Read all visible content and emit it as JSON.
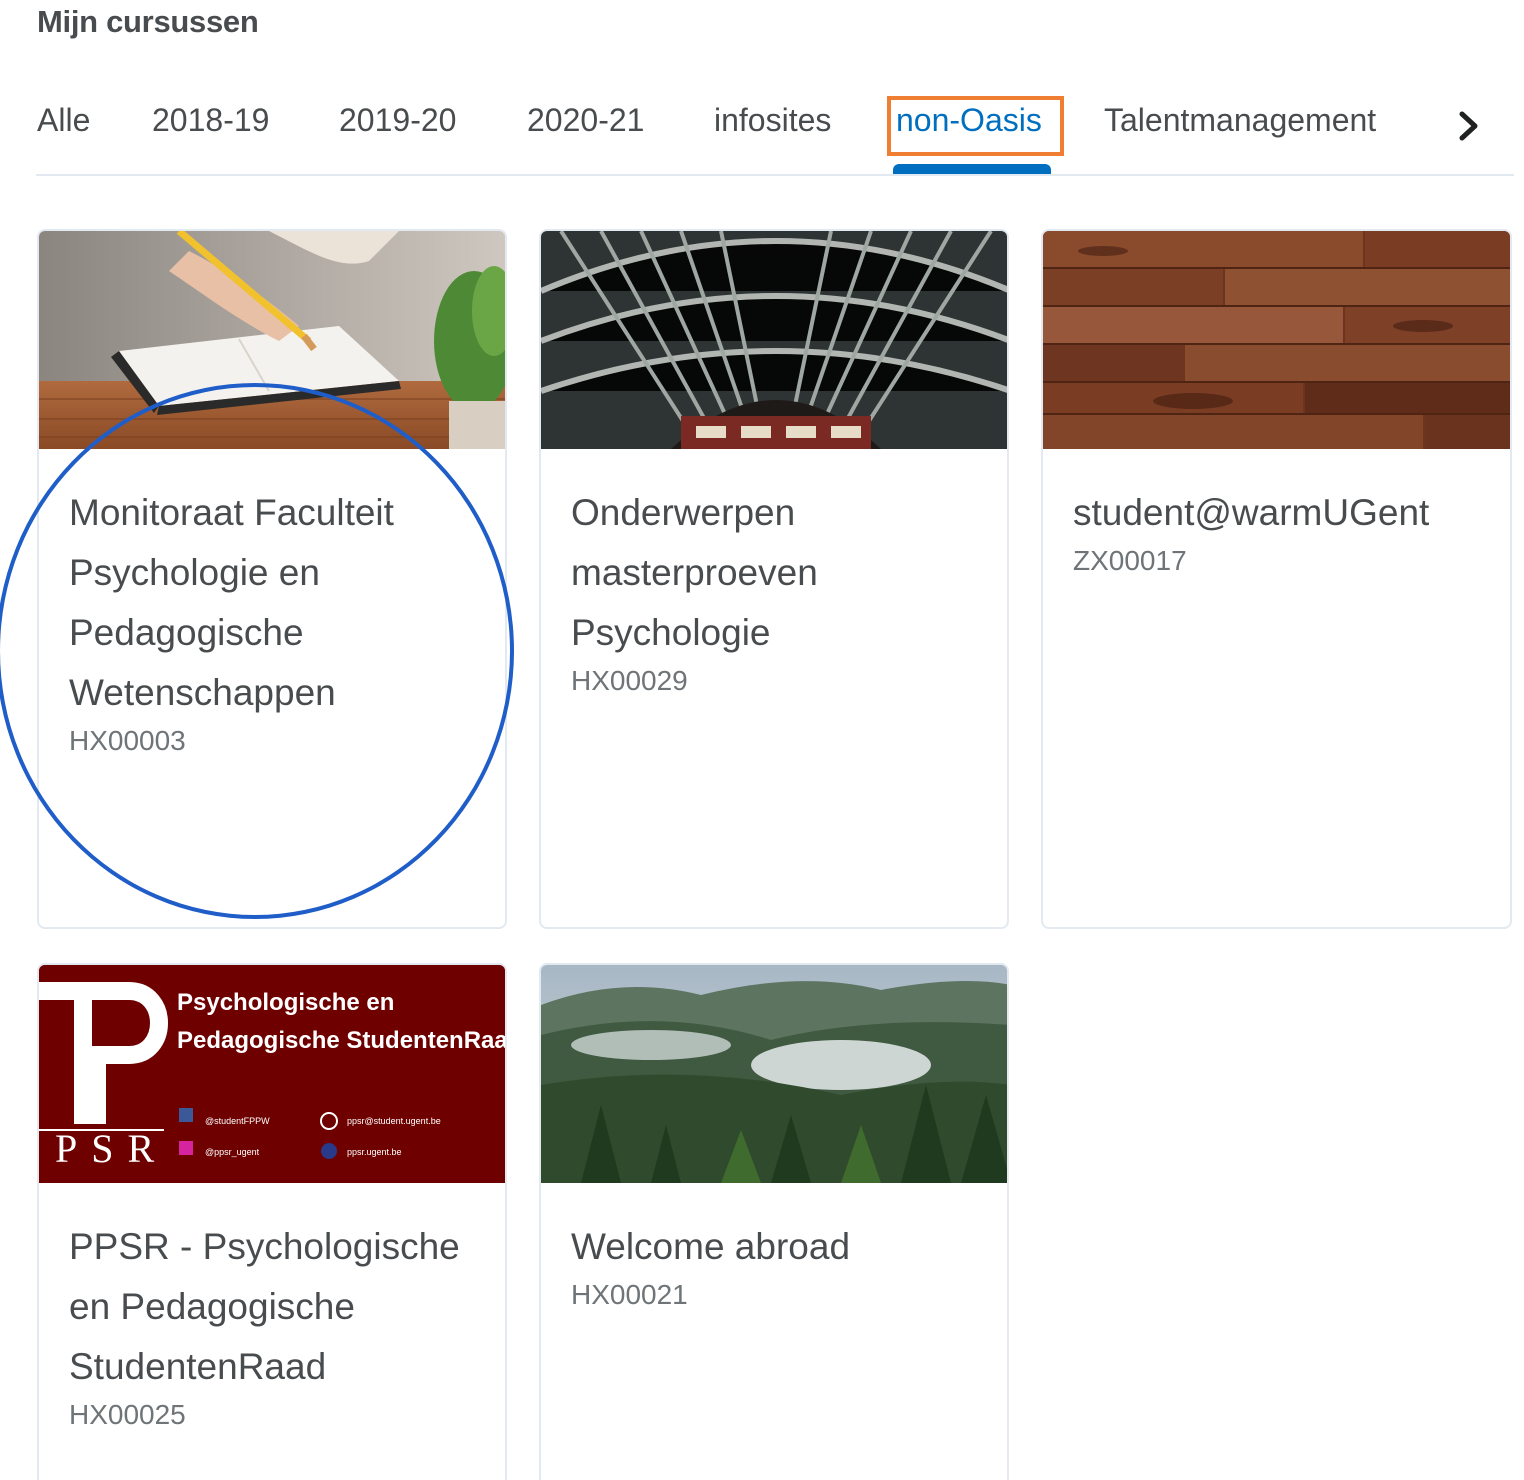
{
  "header": {
    "title": "Mijn cursussen"
  },
  "tabs": [
    {
      "label": "Alle"
    },
    {
      "label": "2018-19"
    },
    {
      "label": "2019-20"
    },
    {
      "label": "2020-21"
    },
    {
      "label": "infosites"
    },
    {
      "label": "non-Oasis",
      "active": true
    },
    {
      "label": "Talentmanagement"
    }
  ],
  "colors": {
    "accent": "#006fbf",
    "highlight_box": "#ef7d32",
    "circle_annotation": "#1f5dc8",
    "ppsr_banner": "#6e0000"
  },
  "courses": [
    {
      "title": "Monitoraat Faculteit Psychologie en Pedagogische Wetenschappen",
      "code": "HX00003",
      "image": "notebook-writing-photo"
    },
    {
      "title": "Onderwerpen masterproeven Psychologie",
      "code": "HX00029",
      "image": "arched-roof-photo"
    },
    {
      "title": "student@warmUGent",
      "code": "ZX00017",
      "image": "wood-planks-photo"
    },
    {
      "title": "PPSR - Psychologische en Pedagogische StudentenRaad",
      "code": "HX00025",
      "image": "ppsr-banner"
    },
    {
      "title": "Welcome abroad",
      "code": "HX00021",
      "image": "misty-forest-photo"
    }
  ],
  "ppsr_banner": {
    "heading_line1": "Psychologische en",
    "heading_line2": "Pedagogische StudentenRaa",
    "logo_letters": "PSR",
    "facebook": "@studentFPPW",
    "email": "ppsr@student.ugent.be",
    "instagram": "@ppsr_ugent",
    "website": "ppsr.ugent.be"
  }
}
